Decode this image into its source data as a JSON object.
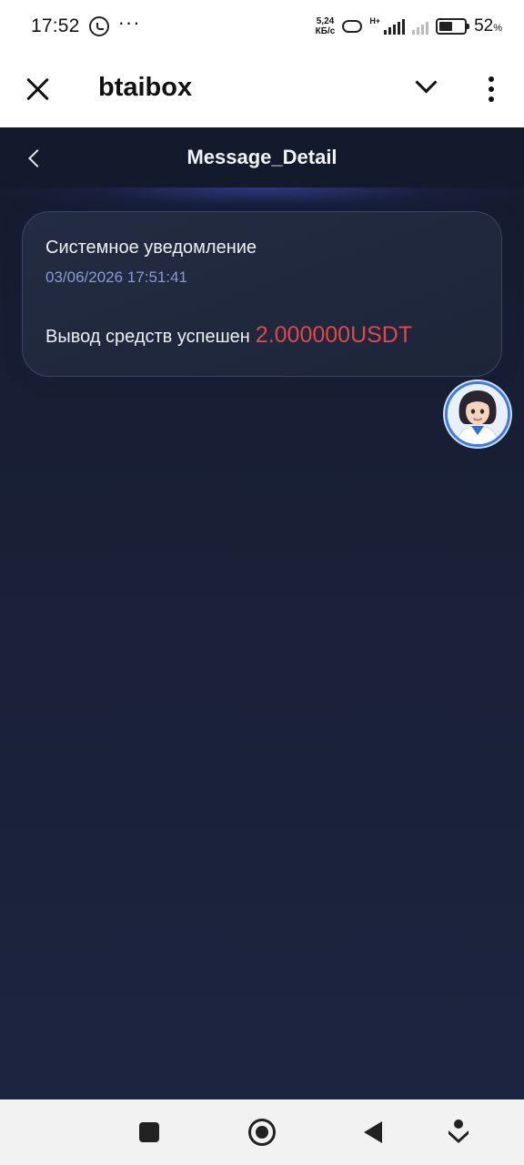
{
  "status_bar": {
    "time": "17:52",
    "more_dots": "···",
    "net_speed_value": "5,24",
    "net_speed_unit": "КБ/с",
    "network_type": "H+",
    "battery_percent": "52",
    "battery_percent_sign": "%"
  },
  "browser": {
    "title": "btaibox"
  },
  "app": {
    "header_title": "Message_Detail",
    "message": {
      "title": "Системное уведомление",
      "date": "03/06/2026 17:51:41",
      "body_text": "Вывод средств успешен",
      "amount": "2.000000USDT"
    }
  },
  "colors": {
    "amount": "#e04848",
    "date": "#8c98d8",
    "app_background": "#192036",
    "avatar_border": "#3d7be0"
  },
  "icons": [
    "close-icon",
    "chevron-down-icon",
    "more-vertical-icon",
    "back-arrow-icon",
    "support-avatar",
    "nav-recents-icon",
    "nav-home-icon",
    "nav-back-icon",
    "nav-assist-icon"
  ]
}
